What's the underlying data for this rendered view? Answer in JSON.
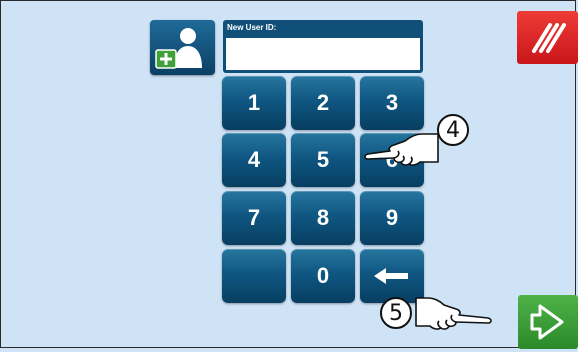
{
  "new_user_panel": {
    "label": "New User ID:",
    "value": ""
  },
  "keypad": {
    "keys": [
      "1",
      "2",
      "3",
      "4",
      "5",
      "6",
      "7",
      "8",
      "9",
      "",
      "0",
      "←"
    ]
  },
  "callouts": {
    "step_a": "4",
    "step_b": "5"
  },
  "icons": {
    "add_user": "add-user-icon",
    "clear": "clear-icon",
    "confirm": "arrow-right-icon",
    "backspace": "backspace-icon",
    "pointer": "pointing-hand-icon"
  },
  "colors": {
    "background": "#cfe3f6",
    "key_blue": "#0f5782",
    "clear_red": "#e42a28",
    "confirm_green": "#3fa13a"
  }
}
